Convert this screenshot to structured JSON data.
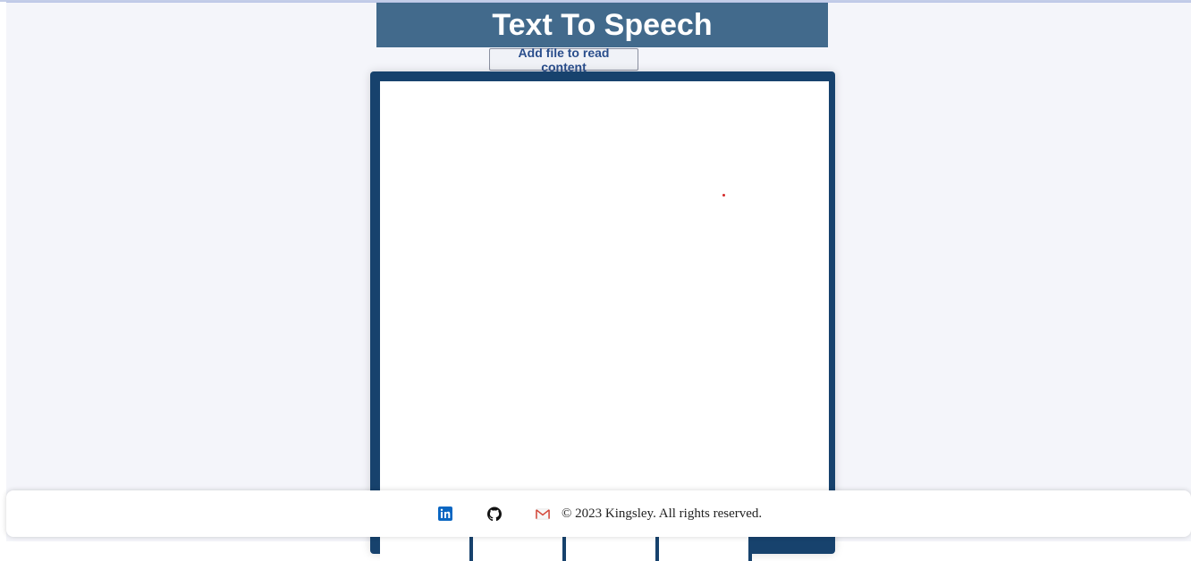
{
  "app": {
    "title": "Text To Speech"
  },
  "toolbar": {
    "add_file_label": "Add file to read content"
  },
  "reader": {
    "content": ""
  },
  "footer": {
    "copyright": "© 2023 Kingsley. All rights reserved.",
    "social": [
      {
        "icon": "linkedin-icon",
        "color": "#0a66c2"
      },
      {
        "icon": "github-icon",
        "color": "#111111"
      },
      {
        "icon": "gmail-icon",
        "color": "#d44638"
      }
    ]
  },
  "colors": {
    "title_bar": "#426a8c",
    "frame": "#17426d",
    "page_background": "#f4f5fa",
    "button_text": "#2a4e8c"
  }
}
